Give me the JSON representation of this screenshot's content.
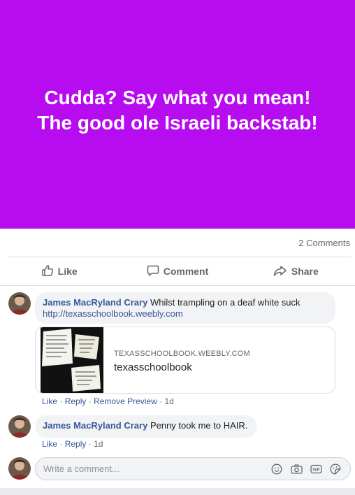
{
  "banner": {
    "line1": "Cudda? Say what you mean!",
    "line2": "The good ole Israeli backstab!",
    "bg_color": "#b80cf0"
  },
  "post_stats": {
    "comments": "2 Comments"
  },
  "actions": {
    "like": "Like",
    "comment": "Comment",
    "share": "Share"
  },
  "comments": [
    {
      "author": "James MacRyland Crary",
      "text": "Whilst trampling on a deaf white suck",
      "link": "http://texasschoolbook.weebly.com",
      "preview": {
        "domain": "TEXASSCHOOLBOOK.WEEBLY.COM",
        "title": "texasschoolbook"
      },
      "meta": {
        "like": "Like",
        "reply": "Reply",
        "remove_preview": "Remove Preview",
        "time": "1d"
      }
    },
    {
      "author": "James MacRyland Crary",
      "text": "Penny took me to HAIR.",
      "meta": {
        "like": "Like",
        "reply": "Reply",
        "time": "1d"
      }
    }
  ],
  "composer": {
    "placeholder": "Write a comment...",
    "icons": [
      "emoji-icon",
      "camera-icon",
      "gif-icon",
      "sticker-icon"
    ]
  },
  "colors": {
    "link": "#385898",
    "muted": "#606770"
  }
}
